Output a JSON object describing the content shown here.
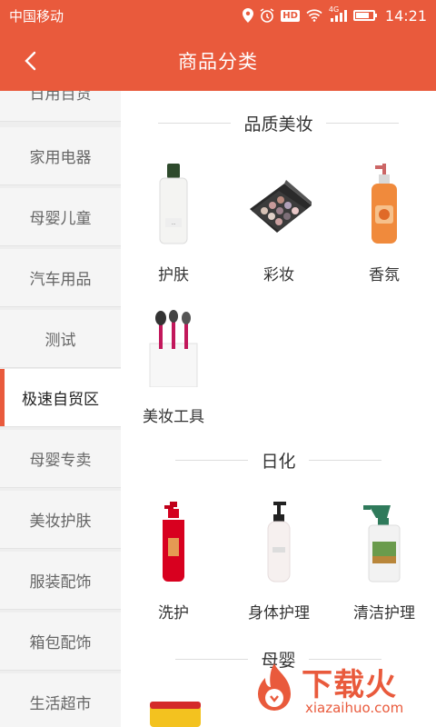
{
  "status_bar": {
    "carrier": "中国移动",
    "hd": "HD",
    "network": "4G",
    "time": "14:21"
  },
  "header": {
    "title": "商品分类"
  },
  "sidebar": {
    "items": [
      {
        "label": "日用百货"
      },
      {
        "label": "家用电器"
      },
      {
        "label": "母婴儿童"
      },
      {
        "label": "汽车用品"
      },
      {
        "label": "测试"
      },
      {
        "label": "极速自贸区",
        "active": true
      },
      {
        "label": "母婴专卖"
      },
      {
        "label": "美妆护肤"
      },
      {
        "label": "服装配饰"
      },
      {
        "label": "箱包配饰"
      },
      {
        "label": "生活超市"
      }
    ]
  },
  "content": {
    "sections": [
      {
        "title": "品质美妆",
        "products": [
          {
            "label": "护肤",
            "icon": "lotion-bottle-icon"
          },
          {
            "label": "彩妆",
            "icon": "eyeshadow-palette-icon"
          },
          {
            "label": "香氛",
            "icon": "fragrance-pump-bottle-icon"
          },
          {
            "label": "美妆工具",
            "icon": "makeup-brushes-icon"
          }
        ]
      },
      {
        "title": "日化",
        "products": [
          {
            "label": "洗护",
            "icon": "shampoo-bottle-icon"
          },
          {
            "label": "身体护理",
            "icon": "body-lotion-bottle-icon"
          },
          {
            "label": "清洁护理",
            "icon": "spray-cleaner-icon"
          }
        ]
      },
      {
        "title": "母婴",
        "products": []
      }
    ]
  },
  "watermark": {
    "brand": "下载火",
    "domain": "xiazaihuo.com"
  },
  "colors": {
    "accent": "#e95a3c",
    "sidebar_bg": "#f5f5f5"
  }
}
